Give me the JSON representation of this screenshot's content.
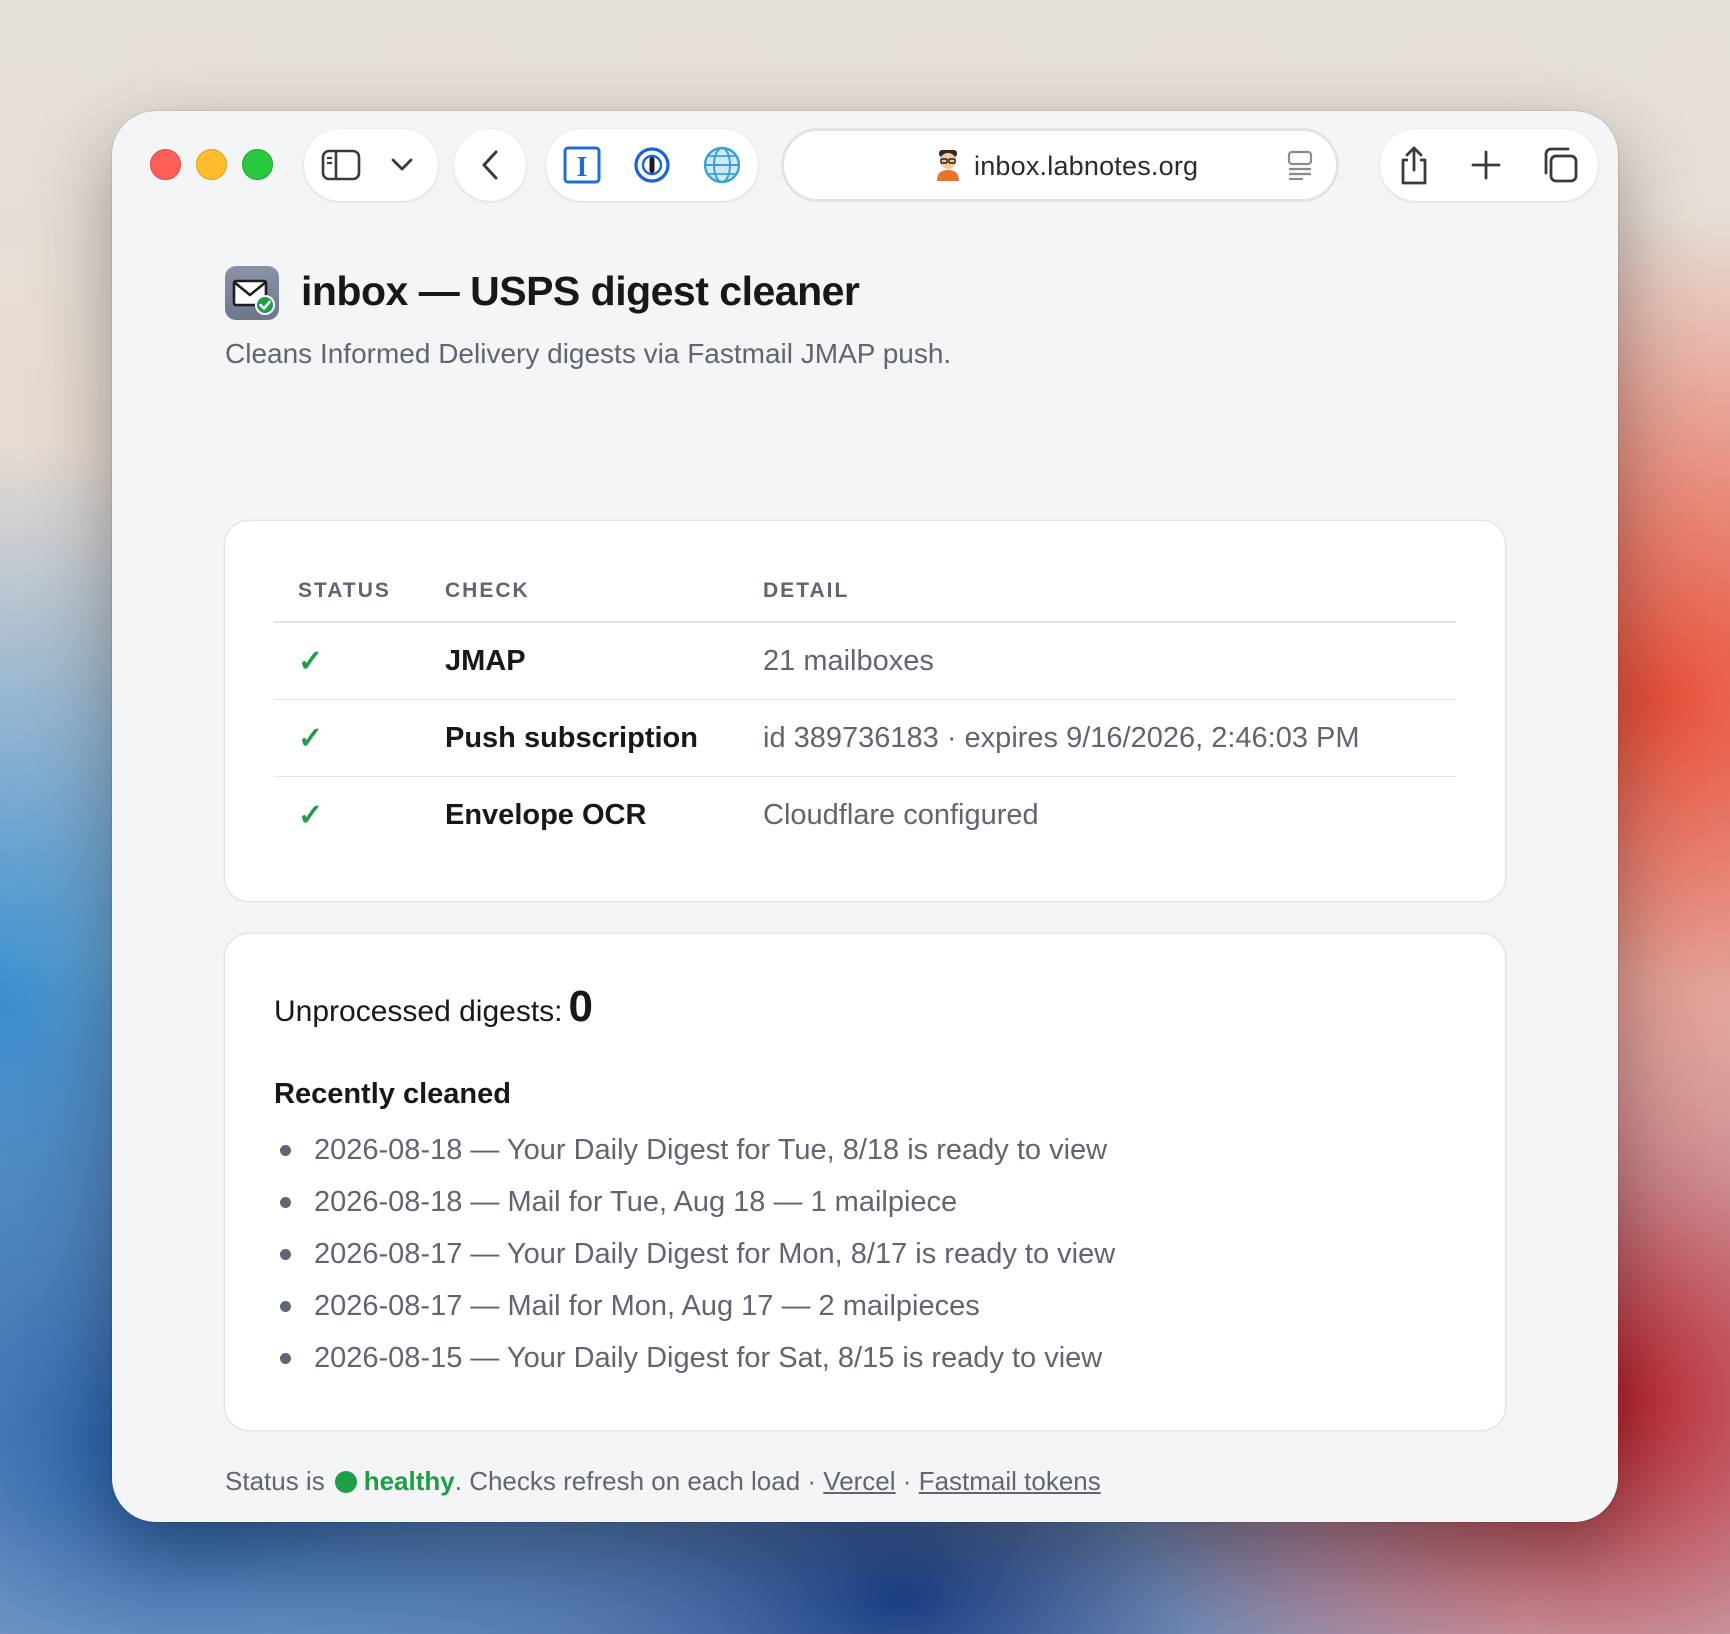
{
  "browser": {
    "url": "inbox.labnotes.org",
    "icons": [
      "sidebar-icon",
      "chevron-down-icon",
      "back-icon",
      "text-cursor-extension-icon",
      "password-manager-icon",
      "globe-icon",
      "reader-icon",
      "share-icon",
      "plus-icon",
      "tabs-overview-icon"
    ]
  },
  "header": {
    "title": "inbox — USPS digest cleaner",
    "subtitle": "Cleans Informed Delivery digests via Fastmail JMAP push."
  },
  "checks": {
    "columns": [
      "STATUS",
      "CHECK",
      "DETAIL"
    ],
    "rows": [
      {
        "status": "✓",
        "check": "JMAP",
        "detail": "21 mailboxes"
      },
      {
        "status": "✓",
        "check": "Push subscription",
        "detail": "id 389736183 · expires 9/16/2026, 2:46:03 PM"
      },
      {
        "status": "✓",
        "check": "Envelope OCR",
        "detail": "Cloudflare configured"
      }
    ]
  },
  "digests": {
    "unprocessed_label": "Unprocessed digests:",
    "unprocessed_count": "0",
    "recent_heading": "Recently cleaned",
    "recent": [
      "2026-08-18 — Your Daily Digest for Tue, 8/18 is ready to view",
      "2026-08-18 — Mail for Tue, Aug 18 — 1 mailpiece",
      "2026-08-17 — Your Daily Digest for Mon, 8/17 is ready to view",
      "2026-08-17 — Mail for Mon, Aug 17 — 2 mailpieces",
      "2026-08-15 — Your Daily Digest for Sat, 8/15 is ready to view"
    ]
  },
  "footer": {
    "prefix": "Status is",
    "status": "healthy",
    "suffix": ". Checks refresh on each load ·",
    "sep": "·",
    "link1": "Vercel",
    "link2": "Fastmail tokens"
  },
  "colors": {
    "ok_green": "#1f9d48",
    "muted_text": "#5f6672",
    "window_bg": "#f4f5f7"
  }
}
